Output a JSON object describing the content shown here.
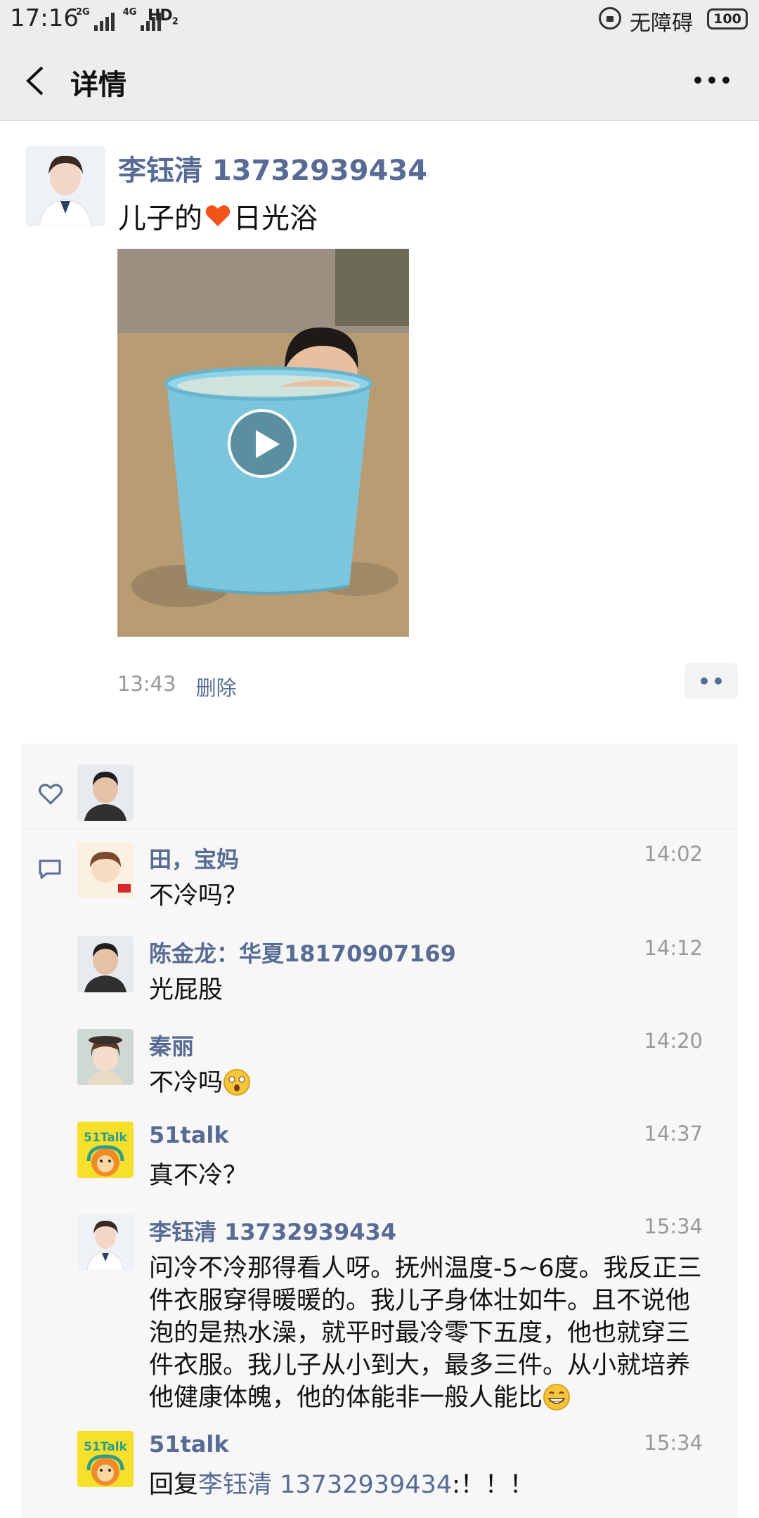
{
  "status_bar": {
    "time": "17:16",
    "net1": "2G",
    "net2": "4G",
    "hd": "HD",
    "hd_sub": "2",
    "accessibility_label": "无障碍",
    "battery": "100"
  },
  "nav": {
    "title": "详情",
    "back_icon": "chevron-left-icon",
    "more_icon": "more-icon"
  },
  "post": {
    "author": "李钰清 13732939434",
    "text_before": "儿子的",
    "text_after": "日光浴",
    "emoji": "heart",
    "time": "13:43",
    "delete_label": "删除"
  },
  "comments": [
    {
      "name": "田，宝妈",
      "time": "14:02",
      "text": "不冷吗？"
    },
    {
      "name": "陈金龙：华夏18170907169",
      "time": "14:12",
      "text": "光屁股"
    },
    {
      "name": "秦丽",
      "time": "14:20",
      "text": "不冷吗"
    },
    {
      "name": "51talk",
      "time": "14:37",
      "text": "真不冷？"
    },
    {
      "name": "李钰清 13732939434",
      "time": "15:34",
      "text": "问冷不冷那得看人呀。抚州温度-5~6度。我反正三件衣服穿得暖暖的。我儿子身体壮如牛。且不说他泡的是热水澡，就平时最冷零下五度，他也就穿三件衣服。我儿子从小到大，最多三件。从小就培养他健康体魄，他的体能非一般人能比"
    },
    {
      "name": "51talk",
      "time": "15:34",
      "reply_prefix": "回复",
      "reply_to": "李钰清 13732939434",
      "text": ":！！！"
    }
  ],
  "logo_text": "51Talk"
}
